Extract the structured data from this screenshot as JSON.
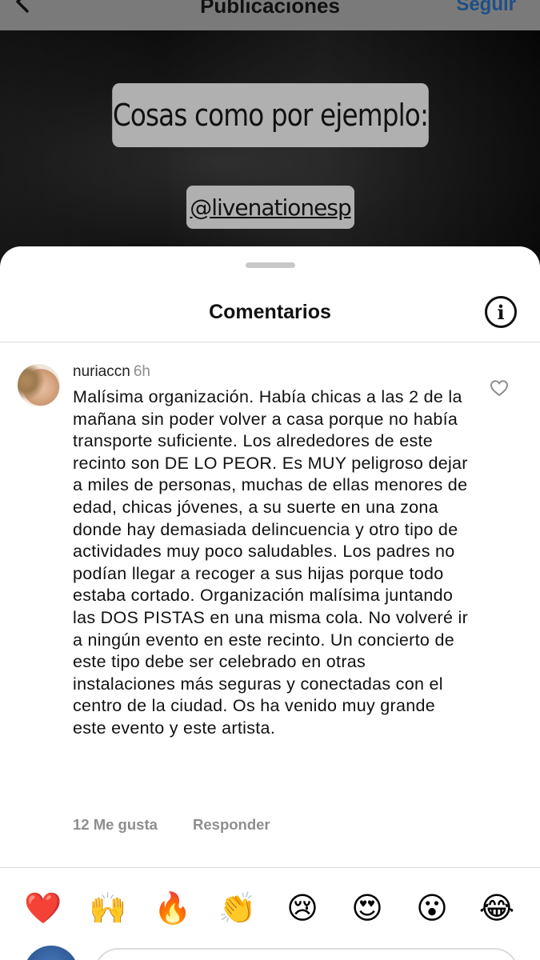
{
  "nav": {
    "title": "Publicaciones",
    "follow_label": "Seguir"
  },
  "story": {
    "caption": "Cosas como por ejemplo:",
    "mention": "@livenationesp"
  },
  "comments_sheet": {
    "title": "Comentarios",
    "info_glyph": "i",
    "comment": {
      "username": "nuriaccn",
      "time": "6h",
      "text": "Malísima organización. Había chicas a las 2 de la mañana sin poder volver a casa porque no había transporte suficiente. Los alrededores de este recinto son DE LO PEOR. Es MUY peligroso dejar a miles de personas, muchas de ellas menores de edad, chicas jóvenes, a su suerte en una zona donde hay demasiada delincuencia y otro tipo de actividades muy poco saludables. Los padres no podían llegar a recoger a sus hijas porque todo estaba cortado. Organización malísima juntando las DOS PISTAS en una misma cola. No volveré ir a ningún evento en este recinto. Un concierto de este tipo debe ser celebrado en otras instalaciones más seguras y conectadas con el centro de la ciudad. Os ha venido muy grande este evento y este artista.",
      "likes_label": "12 Me gusta",
      "reply_label": "Responder"
    },
    "emoji_reactions": [
      {
        "name": "red-heart",
        "glyph": "❤️"
      },
      {
        "name": "raising-hands",
        "glyph": "🙌"
      },
      {
        "name": "fire",
        "glyph": "🔥"
      },
      {
        "name": "clapping-hands",
        "glyph": "👏"
      },
      {
        "name": "crying-face",
        "glyph": "😢"
      },
      {
        "name": "heart-eyes",
        "glyph": "😍"
      },
      {
        "name": "astonished-face",
        "glyph": "😮"
      },
      {
        "name": "tears-of-joy",
        "glyph": "😂"
      }
    ]
  },
  "colors": {
    "follow_blue": "#1d4f86",
    "secondary_text": "#8e8e8e",
    "divider": "#dcdcdc"
  }
}
